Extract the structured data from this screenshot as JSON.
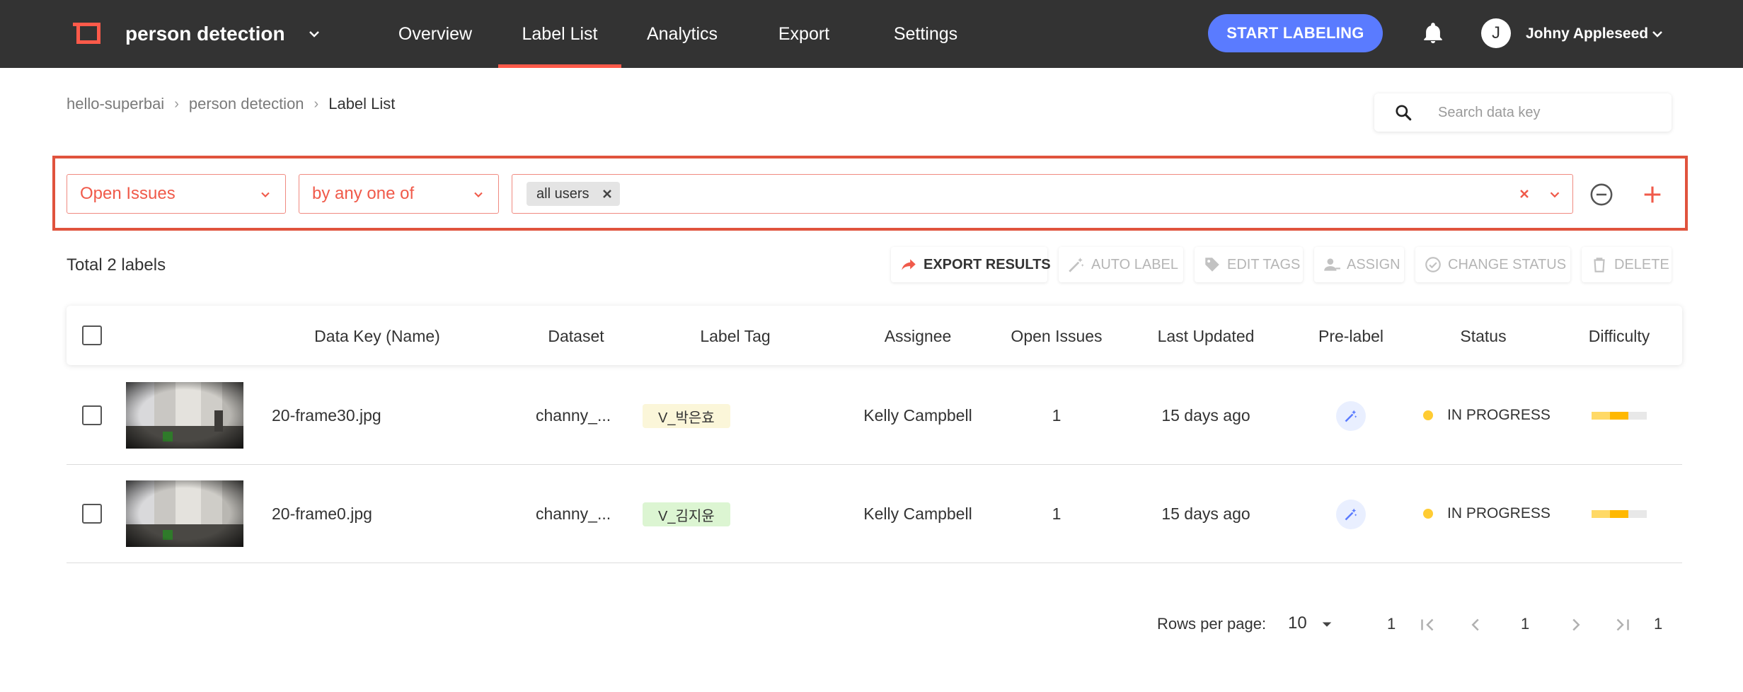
{
  "header": {
    "project_name": "person detection",
    "nav": [
      "Overview",
      "Label List",
      "Analytics",
      "Export",
      "Settings"
    ],
    "active_nav": "Label List",
    "start_button": "START LABELING",
    "avatar_letter": "J",
    "user_name": "Johny Appleseed",
    "brand_color": "#ff5a4a",
    "accent_color": "#5a7bff"
  },
  "breadcrumb": [
    "hello-superbai",
    "person detection",
    "Label List"
  ],
  "breadcrumb_sep": "›",
  "search": {
    "placeholder": "Search data key"
  },
  "filter": {
    "field": "Open Issues",
    "operator": "by any one of",
    "chips": [
      "all users"
    ]
  },
  "toolbar": {
    "total": "Total 2 labels",
    "buttons": [
      {
        "label": "EXPORT RESULTS",
        "icon": "share-arrow-icon",
        "enabled": true
      },
      {
        "label": "AUTO LABEL",
        "icon": "magic-wand-icon",
        "enabled": false
      },
      {
        "label": "EDIT TAGS",
        "icon": "tag-icon",
        "enabled": false
      },
      {
        "label": "ASSIGN",
        "icon": "assign-user-icon",
        "enabled": false
      },
      {
        "label": "CHANGE STATUS",
        "icon": "check-circle-icon",
        "enabled": false
      },
      {
        "label": "DELETE",
        "icon": "trash-icon",
        "enabled": false
      }
    ]
  },
  "table": {
    "columns": [
      "Data Key (Name)",
      "Dataset",
      "Label Tag",
      "Assignee",
      "Open Issues",
      "Last Updated",
      "Pre-label",
      "Status",
      "Difficulty"
    ],
    "rows": [
      {
        "data_key": "20-frame30.jpg",
        "dataset": "channy_...",
        "label_tag": "V_박은효",
        "tag_color": "#fbf6d9",
        "assignee": "Kelly Campbell",
        "open_issues": "1",
        "last_updated": "15 days ago",
        "status": "IN PROGRESS",
        "status_color": "#ffcc33",
        "difficulty_level": 3,
        "difficulty_max": 5
      },
      {
        "data_key": "20-frame0.jpg",
        "dataset": "channy_...",
        "label_tag": "V_김지윤",
        "tag_color": "#dcf5d2",
        "assignee": "Kelly Campbell",
        "open_issues": "1",
        "last_updated": "15 days ago",
        "status": "IN PROGRESS",
        "status_color": "#ffcc33",
        "difficulty_level": 3,
        "difficulty_max": 5
      }
    ]
  },
  "pagination": {
    "rows_per_page_label": "Rows per page:",
    "rows_per_page": "10",
    "first_page": "1",
    "current_page": "1",
    "last_page": "1"
  }
}
